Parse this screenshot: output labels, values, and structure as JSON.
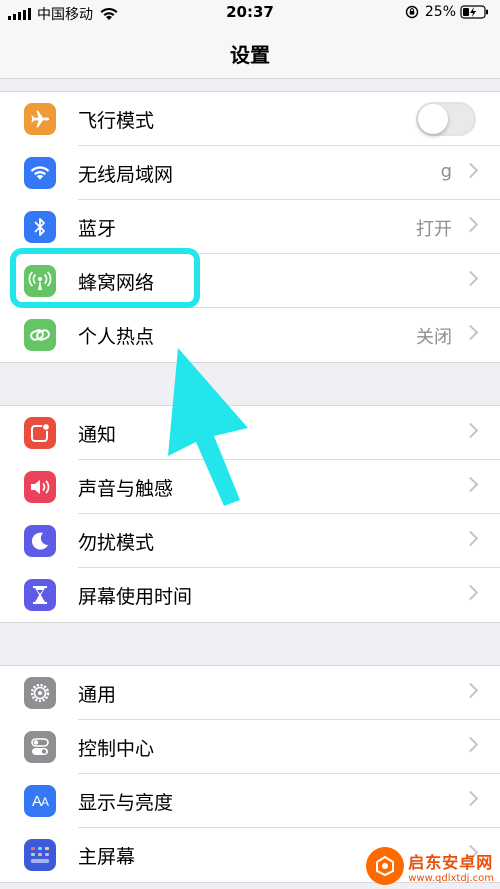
{
  "status_bar": {
    "carrier": "中国移动",
    "time": "20:37",
    "battery": "25%"
  },
  "nav": {
    "title": "设置"
  },
  "groups": [
    {
      "rows": [
        {
          "label": "飞行模式",
          "value": "",
          "icon": "airplane-icon",
          "color": "#f09a37",
          "control": "toggle",
          "toggle_on": false
        },
        {
          "label": "无线局域网",
          "value": "g",
          "icon": "wifi-icon",
          "color": "#3478f6",
          "control": "chevron"
        },
        {
          "label": "蓝牙",
          "value": "打开",
          "icon": "bluetooth-icon",
          "color": "#3478f6",
          "control": "chevron"
        },
        {
          "label": "蜂窝网络",
          "value": "",
          "icon": "cellular-antenna-icon",
          "color": "#65c466",
          "control": "chevron"
        },
        {
          "label": "个人热点",
          "value": "关闭",
          "icon": "hotspot-chain-icon",
          "color": "#65c466",
          "control": "chevron"
        }
      ]
    },
    {
      "rows": [
        {
          "label": "通知",
          "value": "",
          "icon": "notification-icon",
          "color": "#eb4d3d",
          "control": "chevron"
        },
        {
          "label": "声音与触感",
          "value": "",
          "icon": "speaker-icon",
          "color": "#eb445a",
          "control": "chevron"
        },
        {
          "label": "勿扰模式",
          "value": "",
          "icon": "moon-icon",
          "color": "#5e5ce6",
          "control": "chevron"
        },
        {
          "label": "屏幕使用时间",
          "value": "",
          "icon": "hourglass-icon",
          "color": "#5e5ce6",
          "control": "chevron"
        }
      ]
    },
    {
      "rows": [
        {
          "label": "通用",
          "value": "",
          "icon": "gear-icon",
          "color": "#8e8e93",
          "control": "chevron"
        },
        {
          "label": "控制中心",
          "value": "",
          "icon": "switches-icon",
          "color": "#8e8e93",
          "control": "chevron"
        },
        {
          "label": "显示与亮度",
          "value": "",
          "icon": "text-size-icon",
          "color": "#3478f6",
          "control": "chevron"
        },
        {
          "label": "主屏幕",
          "value": "",
          "icon": "home-grid-icon",
          "color": "#3478f6",
          "control": "chevron"
        }
      ]
    }
  ],
  "watermark": {
    "name": "启东安卓网",
    "url": "www.qdlxtdj.com"
  },
  "colors": {
    "highlight": "#23e6ec",
    "background": "#efeff4"
  }
}
